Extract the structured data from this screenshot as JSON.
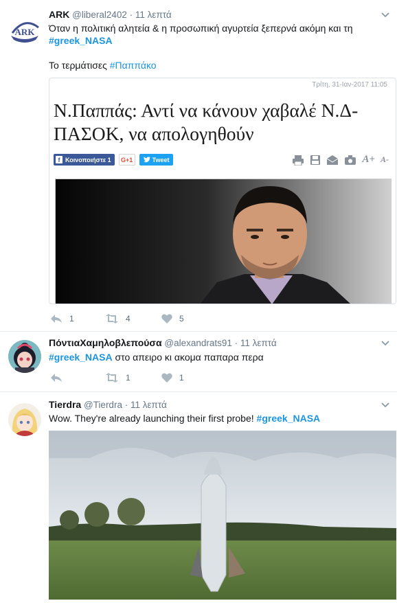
{
  "tweets": [
    {
      "name": "ARK",
      "handle": "@liberal2402",
      "time": "11 λεπτά",
      "text_line1": "Όταν η πολιτική αλητεία & η προσωπική αγυρτεία ξεπερνά ακόμη και τη",
      "hashtag1": "#greek_NASA",
      "text_line2": "Το τερμάτισες",
      "hashtag2": "#Παππάκο",
      "avatar_text": "ARK",
      "card": {
        "date": "Τρίτη, 31-Ιαν-2017 11:05",
        "title": "Ν.Παππάς: Αντί να κάνουν χαβαλέ Ν.Δ-ΠΑΣΟΚ, να απολογηθούν",
        "fb_label": "Κοινοποιήστε 1",
        "gplus_label": "G+1",
        "tweet_label": "Tweet",
        "font_up": "A+",
        "font_down": "A-"
      },
      "replies": "1",
      "retweets": "4",
      "likes": "5"
    },
    {
      "name": "ΠόντιαΧαμηλοβλεπούσα",
      "handle": "@alexandrats91",
      "time": "11 λεπτά",
      "hashtag1": "#greek_NASA",
      "text_rest": "στο απειρο κι ακομα παπαρα περα",
      "replies": "",
      "retweets": "1",
      "likes": "1"
    },
    {
      "name": "Tierdra",
      "handle": "@Tierdra",
      "time": "11 λεπτά",
      "text_before": "Wow. They're already launching their first probe!",
      "hashtag1": "#greek_NASA"
    }
  ],
  "dot": "·",
  "colors": {
    "link": "#1b95e0",
    "meta": "#657786",
    "border": "#e6ecf0"
  }
}
